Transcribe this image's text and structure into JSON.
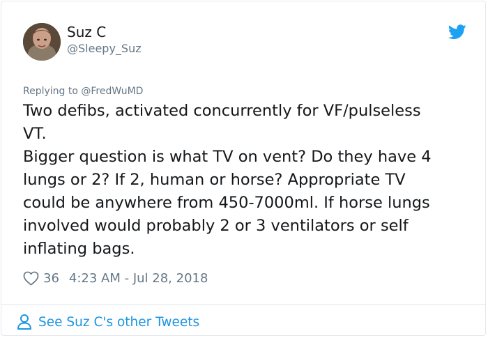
{
  "user": {
    "name": "Suz C",
    "handle": "@Sleepy_Suz",
    "avatar_icon": "profile-photo"
  },
  "reply": {
    "prefix": "Replying to ",
    "target": "@FredWuMD"
  },
  "tweet": {
    "text": "Two defibs, activated concurrently for VF/pulseless\nVT.\nBigger question is what TV on vent? Do they have 4\nlungs or 2? If 2, human or horse? Appropriate TV\ncould be anywhere from 450-7000ml. If horse lungs\ninvolved would probably 2 or 3 ventilators or self\ninflating bags."
  },
  "meta": {
    "like_icon": "heart-icon",
    "likes": "36",
    "timestamp": "4:23 AM - Jul 28, 2018"
  },
  "footer": {
    "icon": "person-icon",
    "label": "See Suz C's other Tweets"
  },
  "colors": {
    "accent": "#1b95e0",
    "twitter_blue": "#1da1f2",
    "secondary_text": "#657786",
    "primary_text": "#14171a",
    "border": "#e1e8ed"
  }
}
